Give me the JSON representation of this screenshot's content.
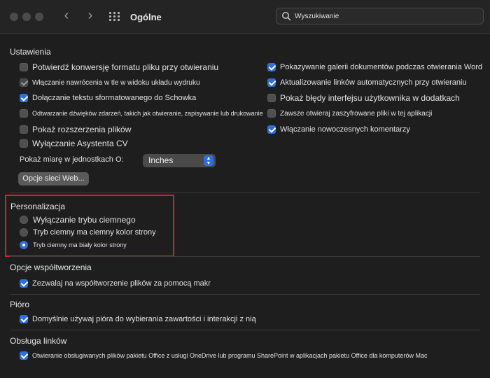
{
  "window": {
    "title": "Ogólne",
    "search_placeholder": "Wyszukiwanie"
  },
  "ustawienia": {
    "title": "Ustawienia",
    "left": [
      {
        "label": "Potwierdź konwersję formatu pliku przy otwieraniu",
        "checked": false
      },
      {
        "label": "Włączanie nawrócenia w tle w widoku układu wydruku",
        "checked": true,
        "dim": true
      },
      {
        "label": "Dołączanie tekstu sformatowanego do Schowka",
        "checked": true
      },
      {
        "label": "Odtwarzanie dźwięków zdarzeń, takich jak otwieranie, zapisywanie lub drukowanie",
        "checked": false
      },
      {
        "label": "Pokaż rozszerzenia plików",
        "checked": false
      },
      {
        "label": "Wyłączanie Asystenta CV",
        "checked": false
      }
    ],
    "right": [
      {
        "label": "Pokazywanie galerii dokumentów podczas otwierania Word",
        "checked": true
      },
      {
        "label": "Aktualizowanie linków automatycznych przy otwieraniu",
        "checked": true
      },
      {
        "label": "Pokaż błędy interfejsu użytkownika w dodatkach",
        "checked": false
      },
      {
        "label": "Zawsze otwieraj zaszyfrowane pliki w tej aplikacji",
        "checked": false
      },
      {
        "label": "Włączanie nowoczesnych komentarzy",
        "checked": true
      }
    ],
    "measure_label": "Pokaż miarę w jednostkach O:",
    "measure_value": "Inches",
    "web_options_button": "Opcje sieci Web..."
  },
  "personalizacja": {
    "title": "Personalizacja",
    "options": [
      {
        "label": "Wyłączanie trybu ciemnego",
        "selected": false
      },
      {
        "label": "Tryb ciemny ma ciemny kolor strony",
        "selected": false
      },
      {
        "label": "Tryb ciemny ma biały kolor strony",
        "selected": true
      }
    ]
  },
  "wspoltworzenie": {
    "title": "Opcje współtworzenia",
    "item": {
      "label": "Zezwalaj na współtworzenie plików za pomocą makr",
      "checked": true
    }
  },
  "pioro": {
    "title": "Pióro",
    "item": {
      "label": "Domyślnie używaj pióra do wybierania zawartości i interakcji z nią",
      "checked": true
    }
  },
  "linki": {
    "title": "Obsługa linków",
    "item": {
      "label": "Otwieranie obsługiwanych plików pakietu Office z usługi OneDrive lub programu SharePoint w aplikacjach pakietu Office dla komputerów Mac",
      "checked": true
    }
  },
  "colors": {
    "accent": "#2f6fdc",
    "highlight_box": "#d21f2a",
    "background": "#1e1e1e"
  }
}
